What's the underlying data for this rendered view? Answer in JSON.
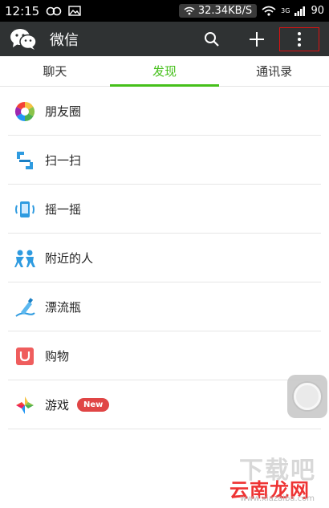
{
  "status_bar": {
    "time": "12:15",
    "speed": "32.34KB/S",
    "network": "3G",
    "battery": "90"
  },
  "app_bar": {
    "title": "微信",
    "actions": [
      "search-icon",
      "plus-icon",
      "more-vert-icon"
    ]
  },
  "tabs": [
    {
      "label": "聊天",
      "active": false
    },
    {
      "label": "发现",
      "active": true
    },
    {
      "label": "通讯录",
      "active": false
    }
  ],
  "menu_items": [
    {
      "label": "朋友圈",
      "icon": "moments-icon"
    },
    {
      "label": "扫一扫",
      "icon": "scan-icon"
    },
    {
      "label": "摇一摇",
      "icon": "shake-icon"
    },
    {
      "label": "附近的人",
      "icon": "people-nearby-icon"
    },
    {
      "label": "漂流瓶",
      "icon": "drift-bottle-icon"
    },
    {
      "label": "购物",
      "icon": "shopping-icon"
    },
    {
      "label": "游戏",
      "icon": "games-icon",
      "badge": "New"
    }
  ],
  "watermark": {
    "top": "下载吧",
    "main": "云南龙网",
    "url": "www.xiazaiba.com"
  },
  "colors": {
    "accent": "#45c01a",
    "app_bar": "#2f3233",
    "badge": "#e04545"
  }
}
